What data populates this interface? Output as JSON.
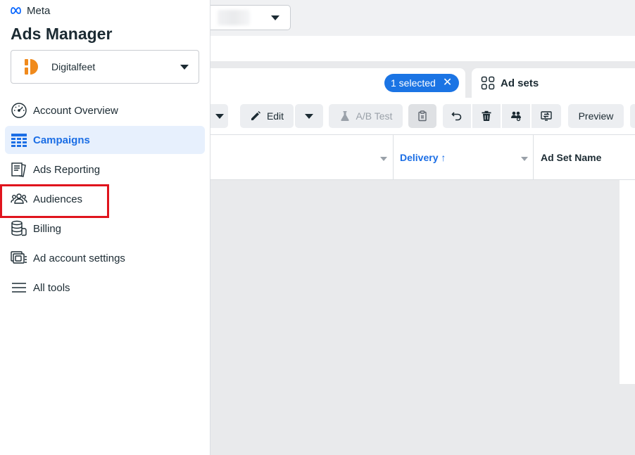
{
  "brand": {
    "logo_text": "Meta",
    "app_title": "Ads Manager",
    "accent": "#1b74e4"
  },
  "account": {
    "name": "Digitalfeet"
  },
  "nav": [
    {
      "label": "Account Overview",
      "icon": "gauge-icon"
    },
    {
      "label": "Campaigns",
      "icon": "table-grid-icon",
      "active": true
    },
    {
      "label": "Ads Reporting",
      "icon": "report-icon"
    },
    {
      "label": "Audiences",
      "icon": "people-icon"
    },
    {
      "label": "Billing",
      "icon": "coins-icon"
    },
    {
      "label": "Ad account settings",
      "icon": "settings-cards-icon"
    },
    {
      "label": "All tools",
      "icon": "menu-icon"
    }
  ],
  "tabs": {
    "selected_label": "1 selected",
    "adsets_label": "Ad sets"
  },
  "toolbar": {
    "edit_label": "Edit",
    "abtest_label": "A/B Test",
    "preview_label": "Preview"
  },
  "table": {
    "delivery_header": "Delivery",
    "delivery_sort": "↑",
    "adset_name_header": "Ad Set Name"
  }
}
